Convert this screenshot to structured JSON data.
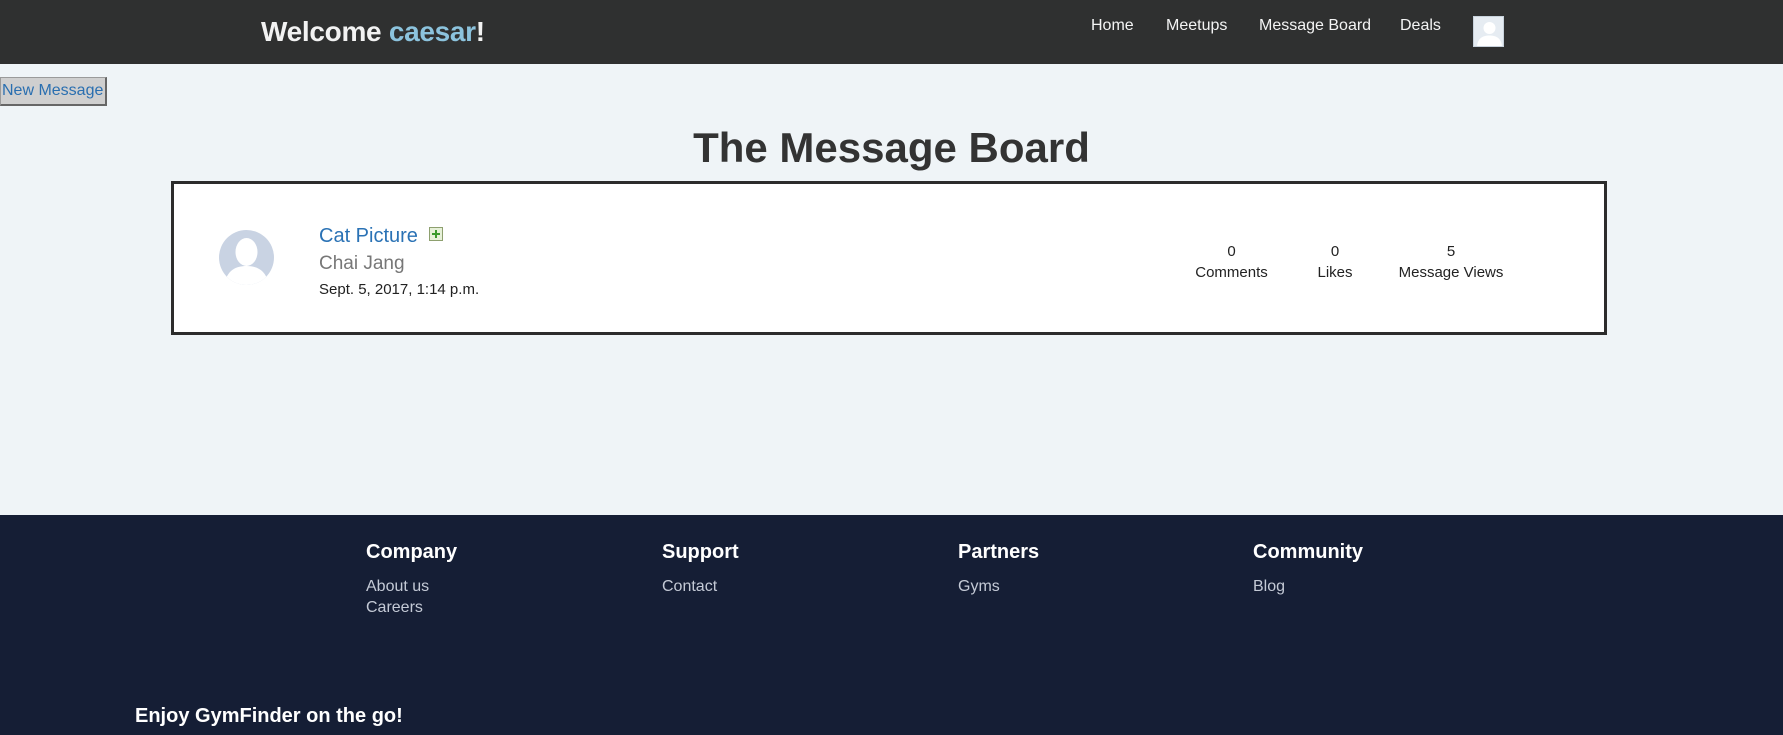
{
  "header": {
    "welcome_prefix": "Welcome ",
    "username": "caesar",
    "welcome_suffix": "!",
    "nav": {
      "home": "Home",
      "meetups": "Meetups",
      "message_board": "Message Board",
      "deals": "Deals"
    },
    "profile_icon": "user-avatar-icon"
  },
  "actions": {
    "new_message": "New Message"
  },
  "page_title": "The Message Board",
  "messages": [
    {
      "title": "Cat Picture",
      "attachment_icon": "image-plus-icon",
      "author": "Chai Jang",
      "date": "Sept. 5, 2017, 1:14 p.m.",
      "comments_count": "0",
      "comments_label": "Comments",
      "likes_count": "0",
      "likes_label": "Likes",
      "views_count": "5",
      "views_label": "Message Views"
    }
  ],
  "footer": {
    "company": {
      "heading": "Company",
      "links": [
        "About us",
        "Careers"
      ]
    },
    "support": {
      "heading": "Support",
      "links": [
        "Contact"
      ]
    },
    "partners": {
      "heading": "Partners",
      "links": [
        "Gyms"
      ]
    },
    "community": {
      "heading": "Community",
      "links": [
        "Blog"
      ]
    },
    "tagline": "Enjoy GymFinder on the go!"
  },
  "colors": {
    "topbar": "#2f3030",
    "username": "#8cc3dd",
    "link_blue": "#2a72b5",
    "page_bg": "#eff4f7",
    "footer_bg": "#151e35"
  }
}
